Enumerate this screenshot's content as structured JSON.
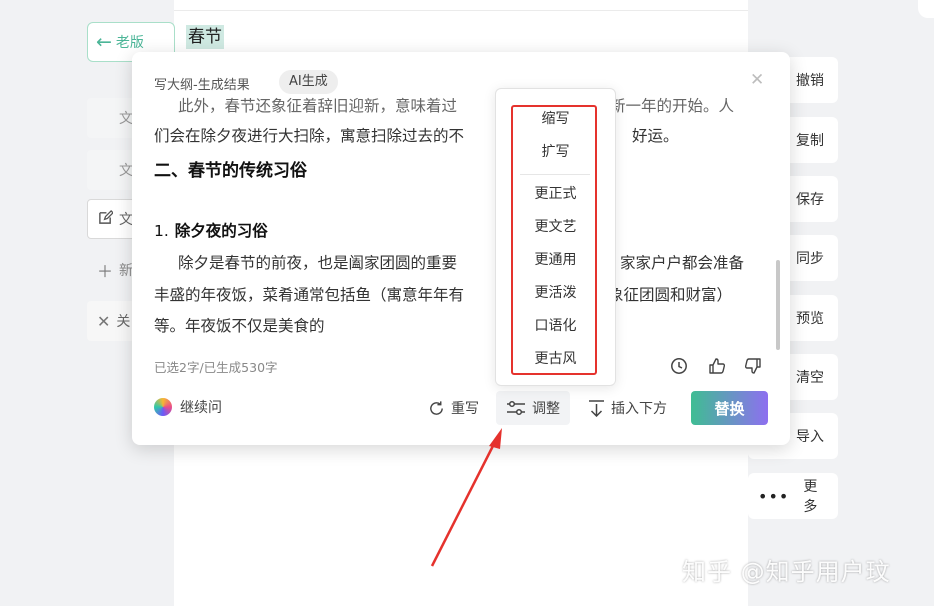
{
  "background": {
    "old_version_label": "老版",
    "doc_heading": "春节",
    "left_items": [
      "文",
      "文",
      "文",
      "新",
      "关"
    ]
  },
  "right_toolbar": {
    "items": [
      "撤销",
      "复制",
      "保存",
      "同步",
      "预览",
      "清空",
      "导入"
    ],
    "more_label": "更多"
  },
  "panel": {
    "title": "写大纲-生成结果",
    "badge": "AI生成",
    "lines": {
      "l1": "此外，春节还象征着辞旧迎新，意味着过",
      "l1b": "新一年的开始。人",
      "l2": "们会在除夕夜进行大扫除，寓意扫除过去的不",
      "l2b": "好运。",
      "h2": "二、春节的传统习俗",
      "h3_num": "1.",
      "h3": "除夕夜的习俗",
      "p1": "除夕是春节的前夜，也是阖家团圆的重要",
      "p1b": "家家户户都会准备",
      "p2": "丰盛的年夜饭，菜肴通常包括鱼（寓意年年有",
      "p2b": "象征团圆和财富）",
      "p3": "等。年夜饭不仅是美食的"
    },
    "status": "已选2字/已生成530字",
    "continue_label": "继续问",
    "tools": {
      "rewrite": "重写",
      "adjust": "调整",
      "insert_below": "插入下方"
    },
    "replace_label": "替换"
  },
  "adjust_menu": {
    "items": [
      "缩写",
      "扩写",
      "更正式",
      "更文艺",
      "更通用",
      "更活泼",
      "口语化",
      "更古风"
    ]
  },
  "watermark": "知乎 @知乎用户玟",
  "colors": {
    "accent_green": "#3fbd93",
    "accent_purple": "#8e6ff0",
    "annotation_red": "#e5322d"
  }
}
